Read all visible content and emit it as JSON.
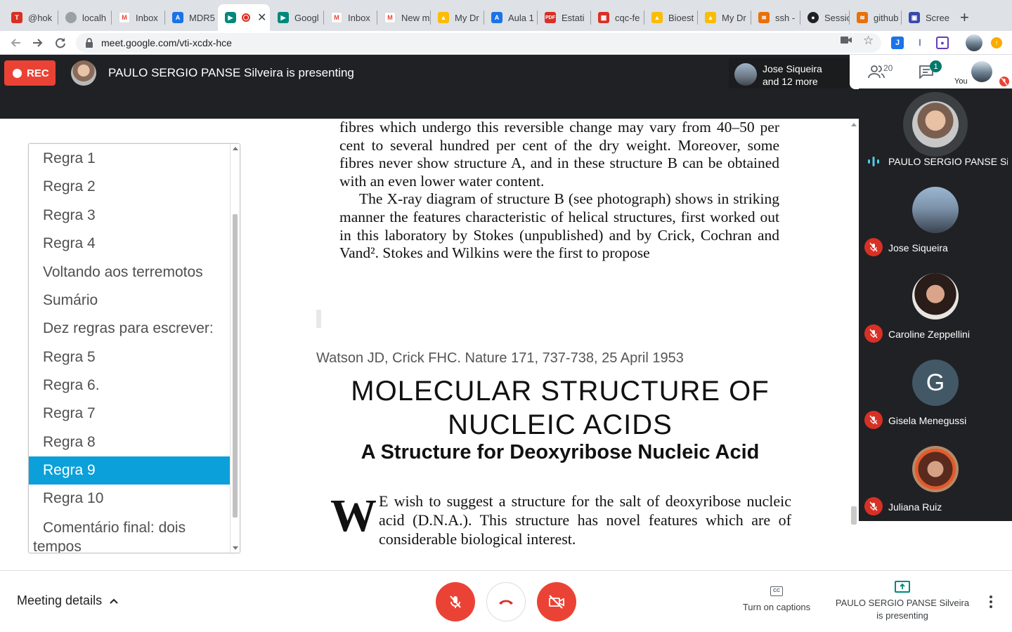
{
  "browser": {
    "tabs": [
      {
        "title": "@hok",
        "color": "#d93025",
        "glyph": "T"
      },
      {
        "title": "localh",
        "color": "#9aa0a6",
        "glyph": "⚙"
      },
      {
        "title": "Inbox",
        "color": "#ea4335",
        "glyph": "M"
      },
      {
        "title": "MDR5",
        "color": "#1a73e8",
        "glyph": "A"
      },
      {
        "title": "",
        "color": "#00897b",
        "glyph": "▶",
        "active": true
      },
      {
        "title": "Googl",
        "color": "#00897b",
        "glyph": "▶"
      },
      {
        "title": "Inbox",
        "color": "#ea4335",
        "glyph": "M"
      },
      {
        "title": "New m",
        "color": "#ea4335",
        "glyph": "M"
      },
      {
        "title": "My Dr",
        "color": "#fbbc04",
        "glyph": "▲"
      },
      {
        "title": "Aula 1",
        "color": "#1a73e8",
        "glyph": "A"
      },
      {
        "title": "Estati",
        "color": "#d93025",
        "glyph": "PDF"
      },
      {
        "title": "cqc-fe",
        "color": "#d93025",
        "glyph": "▦"
      },
      {
        "title": "Bioest",
        "color": "#fbbc04",
        "glyph": "▲"
      },
      {
        "title": "My Dr",
        "color": "#fbbc04",
        "glyph": "▲"
      },
      {
        "title": "ssh -",
        "color": "#e8710a",
        "glyph": "≋"
      },
      {
        "title": "Sessio",
        "color": "#202124",
        "glyph": "●"
      },
      {
        "title": "github",
        "color": "#e8710a",
        "glyph": "≋"
      },
      {
        "title": "Scree",
        "color": "#3949ab",
        "glyph": "▣"
      }
    ],
    "new_tab": "+",
    "url": "meet.google.com/vti-xcdx-hce"
  },
  "meet": {
    "rec_label": "REC",
    "presenting_title": "PAULO SERGIO PANSE Silveira is presenting",
    "others_line1": "Jose Siqueira",
    "others_line2": "and 12 more",
    "people_count": "20",
    "chat_badge": "1",
    "you_label": "You"
  },
  "slides_list": {
    "items": [
      "Regra 1",
      "Regra 2",
      "Regra 3",
      "Regra 4",
      "Voltando aos terremotos",
      "Sumário",
      "Dez regras para escrever:",
      "Regra 5",
      "Regra 6.",
      "Regra 7",
      "Regra 8",
      "Regra 9",
      "Regra 10",
      "Comentário final: dois tempos"
    ],
    "selected": "Regra 9"
  },
  "slide": {
    "scan_paragraph_1": "fibres which undergo this reversible change may vary from 40–50 per cent to several hundred per cent of the dry weight. Moreover, some fibres never show structure A, and in these structure B can be obtained with an even lower water content.",
    "scan_paragraph_2": "The X-ray diagram of structure B (see photograph) shows in striking manner the features characteristic of helical structures, first worked out in this laboratory by Stokes (unpublished) and by Crick, Cochran and Vand². Stokes and Wilkins were the first to propose",
    "citation": "Watson JD, Crick FHC. Nature 171, 737-738, 25 April 1953",
    "title": "MOLECULAR STRUCTURE OF NUCLEIC ACIDS",
    "subtitle": "A Structure for Deoxyribose Nucleic Acid",
    "drop_cap": "W",
    "abstract": "E wish to suggest a structure for the salt of deoxyribose nucleic acid (D.N.A.). This structure has novel features which are of considerable biological interest."
  },
  "participants": [
    {
      "name": "PAULO SERGIO PANSE Sil...",
      "speaking": true
    },
    {
      "name": "Jose Siqueira",
      "muted": true
    },
    {
      "name": "Caroline Zeppellini",
      "muted": true
    },
    {
      "name": "Gisela Menegussi",
      "muted": true,
      "initial": "G"
    },
    {
      "name": "Juliana Ruiz",
      "muted": true
    }
  ],
  "bottom": {
    "meeting_details": "Meeting details",
    "captions": "Turn on captions",
    "presenting_line1": "PAULO SERGIO PANSE Silveira",
    "presenting_line2": "is presenting"
  },
  "colors": {
    "rec_red": "#ea4335",
    "selection_blue": "#0ba0d9",
    "meet_dark": "#202124",
    "teal": "#00897b"
  }
}
